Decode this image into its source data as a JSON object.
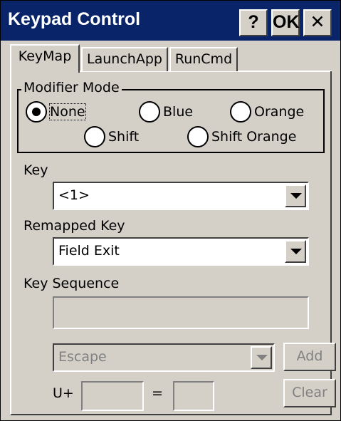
{
  "window": {
    "title": "Keypad Control",
    "help_label": "?",
    "ok_label": "OK",
    "close_label": "✕"
  },
  "tabs": [
    {
      "label": "KeyMap",
      "active": true
    },
    {
      "label": "LaunchApp",
      "active": false
    },
    {
      "label": "RunCmd",
      "active": false
    }
  ],
  "modifier_mode": {
    "legend": "Modifier Mode",
    "options": [
      {
        "label": "None",
        "selected": true
      },
      {
        "label": "Blue",
        "selected": false
      },
      {
        "label": "Orange",
        "selected": false
      },
      {
        "label": "Shift",
        "selected": false
      },
      {
        "label": "Shift Orange",
        "selected": false
      }
    ]
  },
  "key": {
    "label": "Key",
    "value": "<1>"
  },
  "remapped_key": {
    "label": "Remapped Key",
    "value": "Field Exit"
  },
  "key_sequence": {
    "label": "Key Sequence",
    "value": "",
    "select_value": "Escape",
    "add_label": "Add",
    "clear_label": "Clear",
    "unicode_prefix": "U+",
    "equals": "="
  },
  "colors": {
    "titlebar": "#0a246a",
    "face": "#d4d0c8",
    "disabled_text": "#808080"
  }
}
